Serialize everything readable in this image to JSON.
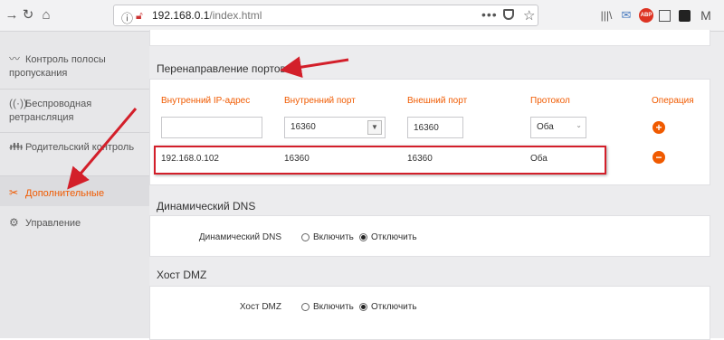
{
  "browser": {
    "url_host": "192.168.0.1",
    "url_path": "/index.html",
    "more_label": "•••",
    "ext_abp_label": "ABP"
  },
  "sidebar": {
    "items": [
      {
        "label": "Контроль полосы пропускания",
        "icon": "bandwidth-icon"
      },
      {
        "label": "Беспроводная ретрансляция",
        "icon": "wireless-icon"
      },
      {
        "label": "Родительский контроль",
        "icon": "parental-icon"
      },
      {
        "label": "Дополнительные",
        "icon": "tools-icon",
        "active": true
      },
      {
        "label": "Управление",
        "icon": "gears-icon"
      }
    ]
  },
  "port_forwarding": {
    "title": "Перенаправление портов",
    "headers": [
      "Внутренний IP-адрес",
      "Внутренний порт",
      "Внешний порт",
      "Протокол",
      "Операция"
    ],
    "new_row": {
      "ip": "",
      "internal_port": "16360",
      "external_port": "16360",
      "protocol": "Оба"
    },
    "rows": [
      {
        "ip": "192.168.0.102",
        "internal_port": "16360",
        "external_port": "16360",
        "protocol": "Оба"
      }
    ]
  },
  "ddns": {
    "title": "Динамический DNS",
    "label": "Динамический DNS",
    "on_label": "Включить",
    "off_label": "Отключить",
    "selected": "off"
  },
  "dmz": {
    "title": "Хост DMZ",
    "label": "Хост DMZ",
    "on_label": "Включить",
    "off_label": "Отключить",
    "selected": "off"
  },
  "colors": {
    "accent": "#f05a00",
    "highlight": "#d31f2a",
    "sidebar_bg": "#e7e7e9",
    "content_bg": "#ececee"
  }
}
